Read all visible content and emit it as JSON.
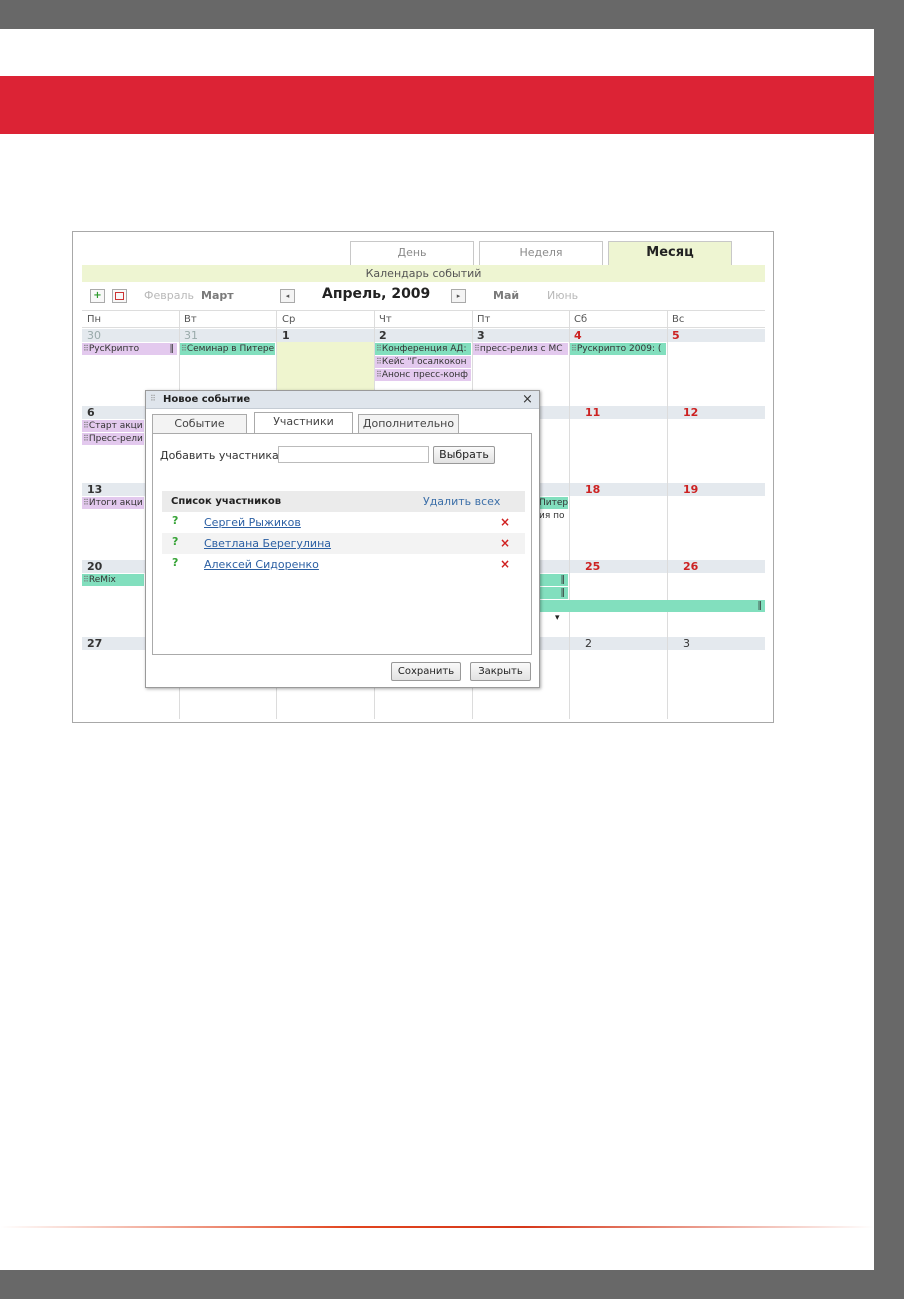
{
  "views": {
    "day": "День",
    "week": "Неделя",
    "month": "Месяц"
  },
  "calendar_title": "Календарь событий",
  "nav": {
    "add_icon": "+",
    "calendar_icon": "calendar-icon",
    "prev_prev_month": "Февраль",
    "prev_month": "Март",
    "prev_arrow": "◂",
    "current": "Апрель, 2009",
    "next_arrow": "▸",
    "next_month": "Май",
    "next_next_month": "Июнь"
  },
  "weekdays": [
    "Пн",
    "Вт",
    "Ср",
    "Чт",
    "Пт",
    "Сб",
    "Вс"
  ],
  "dates": [
    [
      "30",
      "31",
      "1",
      "2",
      "3",
      "4",
      "5"
    ],
    [
      "6",
      "11",
      "12"
    ],
    [
      "13",
      "18",
      "19"
    ],
    [
      "20",
      "25",
      "26"
    ],
    [
      "27",
      "2",
      "3"
    ]
  ],
  "events": {
    "rucrypto": "РусКрипто",
    "seminar": "Семинар в Питере",
    "conference": "Конференция АД:",
    "case": "Кейс \"Госалкокон",
    "anons": "Анонс пресс-конф",
    "press_release": "пресс-релиз с МС",
    "rucrypto2009": "Рускрипто 2009: (",
    "start": "Старт акци",
    "press_rel": "Пресс-рели",
    "itogi": "Итоги акци",
    "piter_tail": "Питере",
    "ia_tail": "ия по",
    "remix": "ReMix",
    "handle": "⠿",
    "bar": "‖",
    "more_arrow": "▾"
  },
  "dialog": {
    "title": "Новое событие",
    "close": "×",
    "tabs": [
      "Событие",
      "Участники",
      "Дополнительно"
    ],
    "add_label": "Добавить участника:",
    "select_button": "Выбрать",
    "list_title": "Список участников",
    "remove_all": "Удалить всех",
    "participants": [
      {
        "name": "Сергей Рыжиков",
        "status": "?",
        "delete": "×"
      },
      {
        "name": "Светлана Берегулина",
        "status": "?",
        "delete": "×"
      },
      {
        "name": "Алексей Сидоренко",
        "status": "?",
        "delete": "×"
      }
    ],
    "save": "Сохранить",
    "close_button": "Закрыть"
  },
  "colors": {
    "frame": "#686868",
    "red_band": "#dc2335",
    "today": "#eff5cf",
    "event_purple": "#e3c9ee",
    "event_green": "#82dfbe",
    "weekend_date": "#cc2222"
  }
}
